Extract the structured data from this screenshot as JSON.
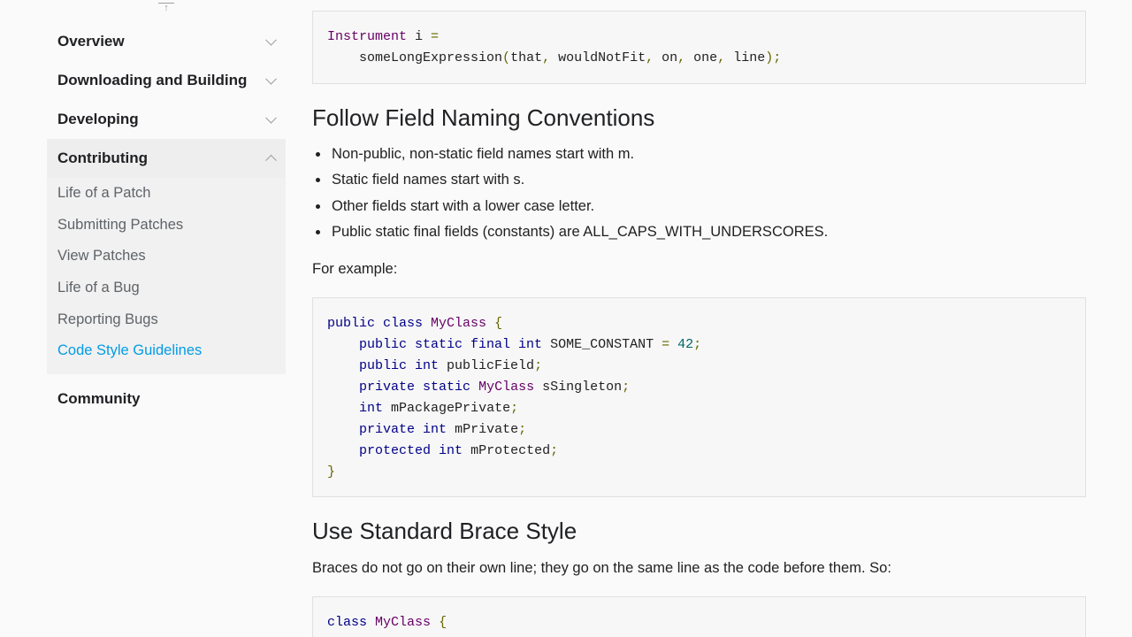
{
  "sidebar": {
    "sections": [
      {
        "label": "Overview",
        "expanded": false
      },
      {
        "label": "Downloading and Building",
        "expanded": false
      },
      {
        "label": "Developing",
        "expanded": false
      },
      {
        "label": "Contributing",
        "expanded": true
      },
      {
        "label": "Community",
        "expanded": false
      }
    ],
    "contributing_items": [
      {
        "label": "Life of a Patch",
        "active": false
      },
      {
        "label": "Submitting Patches",
        "active": false
      },
      {
        "label": "View Patches",
        "active": false
      },
      {
        "label": "Life of a Bug",
        "active": false
      },
      {
        "label": "Reporting Bugs",
        "active": false
      },
      {
        "label": "Code Style Guidelines",
        "active": true
      }
    ],
    "icons": {
      "collapsed": "chevron-down-icon",
      "expanded": "chevron-up-icon",
      "top": "arrow-up-icon"
    },
    "active_color": "#039be5"
  },
  "main": {
    "code1": {
      "line1": [
        "Instrument",
        " i ",
        "="
      ],
      "line2": [
        "    someLongExpression",
        "(",
        "that",
        ", ",
        "wouldNotFit",
        ", ",
        "on",
        ", ",
        "one",
        ", ",
        "line",
        ");"
      ]
    },
    "heading1": "Follow Field Naming Conventions",
    "bullets": [
      "Non-public, non-static field names start with m.",
      "Static field names start with s.",
      "Other fields start with a lower case letter.",
      "Public static final fields (constants) are ALL_CAPS_WITH_UNDERSCORES."
    ],
    "example_intro": "For example:",
    "code2": {
      "l1": {
        "kw": "public class",
        "ty": "MyClass",
        "pn": "{"
      },
      "l2": {
        "kw": "public static final int",
        "pl": "SOME_CONSTANT",
        "op": "=",
        "nm": "42",
        "end": ";"
      },
      "l3": {
        "kw": "public int",
        "pl": "publicField",
        "end": ";"
      },
      "l4": {
        "kw": "private static",
        "ty": "MyClass",
        "pl": "sSingleton",
        "end": ";"
      },
      "l5": {
        "kw": "int",
        "pl": "mPackagePrivate",
        "end": ";"
      },
      "l6": {
        "kw": "private int",
        "pl": "mPrivate",
        "end": ";"
      },
      "l7": {
        "kw": "protected int",
        "pl": "mProtected",
        "end": ";"
      },
      "l8": {
        "pn": "}"
      }
    },
    "heading2": "Use Standard Brace Style",
    "brace_para": "Braces do not go on their own line; they go on the same line as the code before them. So:",
    "code3": {
      "l1": {
        "kw": "class",
        "ty": "MyClass",
        "pn": "{"
      }
    }
  },
  "colors": {
    "keyword": "#000088",
    "type": "#660066",
    "punctuation": "#666600",
    "number": "#006666"
  }
}
